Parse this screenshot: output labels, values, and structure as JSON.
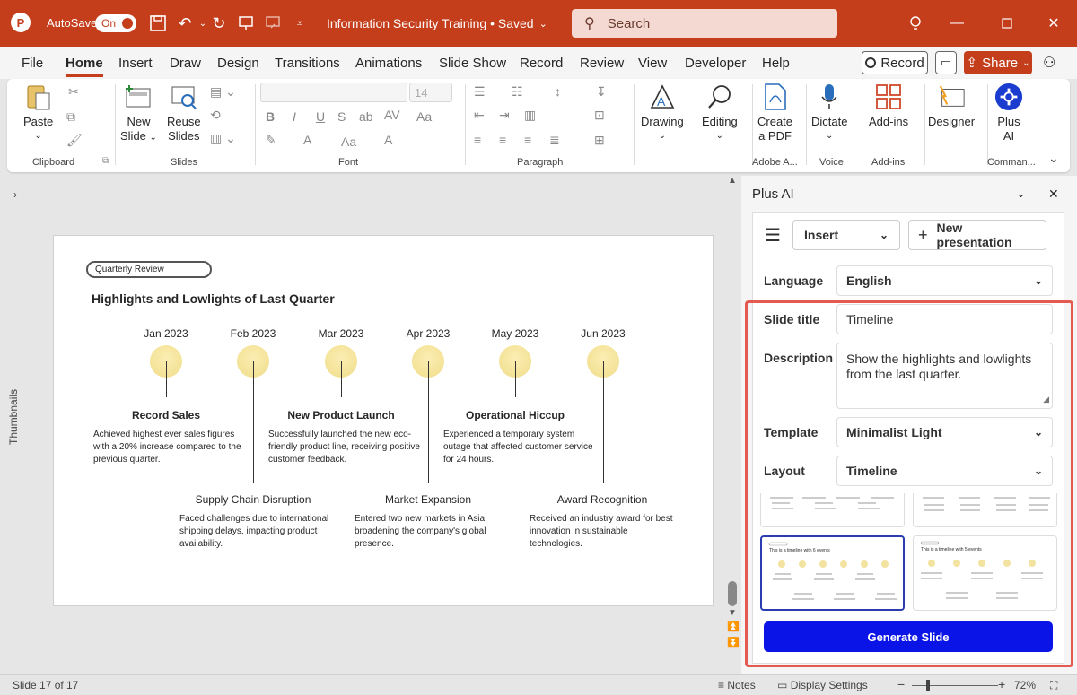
{
  "titlebar": {
    "autosave_label": "AutoSave",
    "toggle_label": "On",
    "doc_title": "Information Security Training • Saved",
    "search_placeholder": "Search"
  },
  "menu": {
    "tabs": [
      "File",
      "Home",
      "Insert",
      "Draw",
      "Design",
      "Transitions",
      "Animations",
      "Slide Show",
      "Record",
      "Review",
      "View",
      "Developer",
      "Help"
    ],
    "active": "Home",
    "record_label": "Record",
    "share_label": "Share"
  },
  "ribbon": {
    "paste": "Paste",
    "new_slide": [
      "New",
      "Slide"
    ],
    "reuse_slides": [
      "Reuse",
      "Slides"
    ],
    "font_size": "14",
    "drawing": "Drawing",
    "editing": "Editing",
    "create_pdf": [
      "Create",
      "a PDF"
    ],
    "dictate": "Dictate",
    "addins": "Add-ins",
    "designer": "Designer",
    "plus_ai": [
      "Plus",
      "AI"
    ],
    "groups": [
      "Clipboard",
      "Slides",
      "Font",
      "Paragraph",
      "Adobe A...",
      "Voice",
      "Add-ins",
      "Comman..."
    ]
  },
  "sidebar": {
    "thumbnails_label": "Thumbnails"
  },
  "slide": {
    "badge": "Quarterly Review",
    "title": "Highlights and Lowlights of Last Quarter",
    "dates": [
      "Jan 2023",
      "Feb 2023",
      "Mar 2023",
      "Apr 2023",
      "May 2023",
      "Jun 2023"
    ],
    "top_events": [
      {
        "title": "Record Sales",
        "desc": "Achieved highest ever sales figures with a 20% increase compared to the previous quarter."
      },
      {
        "title": "New Product Launch",
        "desc": "Successfully launched the new eco-friendly product line, receiving positive customer feedback."
      },
      {
        "title": "Operational Hiccup",
        "desc": "Experienced a temporary system outage that affected customer service for 24 hours."
      }
    ],
    "bottom_events": [
      {
        "title": "Supply Chain Disruption",
        "desc": "Faced challenges due to international shipping delays, impacting product availability."
      },
      {
        "title": "Market Expansion",
        "desc": "Entered two new markets in Asia, broadening the company's global presence."
      },
      {
        "title": "Award Recognition",
        "desc": "Received an industry award for best innovation in sustainable technologies."
      }
    ]
  },
  "pane": {
    "title": "Plus AI",
    "insert_label": "Insert",
    "new_presentation": "New presentation",
    "language_label": "Language",
    "language_value": "English",
    "slide_title_label": "Slide title",
    "slide_title_value": "Timeline",
    "description_label": "Description",
    "description_value": "Show the highlights and lowlights from the last quarter.",
    "template_label": "Template",
    "template_value": "Minimalist Light",
    "layout_label": "Layout",
    "layout_value": "Timeline",
    "thumb_caption_1": "This is a timeline with 6 events",
    "thumb_caption_2": "This is a timeline with 5 events",
    "generate_label": "Generate Slide"
  },
  "status": {
    "slide_counter": "Slide 17 of 17",
    "notes": "Notes",
    "display_settings": "Display Settings",
    "zoom": "72%"
  },
  "colors": {
    "brand": "#c43e1c",
    "accent_blue": "#0a14e6",
    "highlight_red": "#e35a52"
  }
}
